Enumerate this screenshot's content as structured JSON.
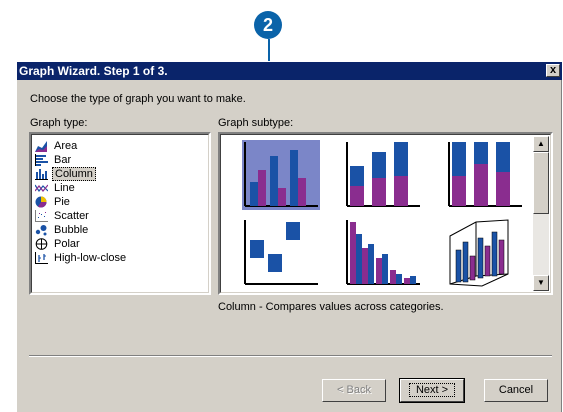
{
  "callout": {
    "number": "2"
  },
  "dialog": {
    "title": "Graph Wizard. Step 1 of 3.",
    "close_label": "x",
    "prompt": "Choose the type of graph you want to make.",
    "graph_type_label": "Graph type:",
    "graph_subtype_label": "Graph subtype:",
    "graph_types": [
      {
        "label": "Area",
        "icon": "area-chart-icon"
      },
      {
        "label": "Bar",
        "icon": "bar-chart-icon"
      },
      {
        "label": "Column",
        "icon": "column-chart-icon",
        "selected": true
      },
      {
        "label": "Line",
        "icon": "line-chart-icon"
      },
      {
        "label": "Pie",
        "icon": "pie-chart-icon"
      },
      {
        "label": "Scatter",
        "icon": "scatter-chart-icon"
      },
      {
        "label": "Bubble",
        "icon": "bubble-chart-icon"
      },
      {
        "label": "Polar",
        "icon": "polar-chart-icon"
      },
      {
        "label": "High-low-close",
        "icon": "high-low-close-icon"
      }
    ],
    "subtypes": [
      {
        "name": "clustered-column",
        "selected": true
      },
      {
        "name": "stacked-column"
      },
      {
        "name": "percent-stacked-column"
      },
      {
        "name": "floating-column"
      },
      {
        "name": "stepped-column"
      },
      {
        "name": "3d-column"
      }
    ],
    "description": "Column - Compares values across categories.",
    "buttons": {
      "back": "< Back",
      "next": "Next >",
      "cancel": "Cancel"
    }
  },
  "colors": {
    "title_bar": "#0a246a",
    "face": "#d4d0c8",
    "callout": "#0a63a9",
    "series_blue": "#1a52a6",
    "series_purple": "#8a2d8f"
  }
}
